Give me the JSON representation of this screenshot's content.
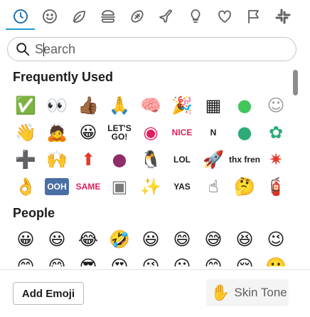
{
  "tabs": [
    {
      "name": "tab-recent",
      "icon": "clock-icon"
    },
    {
      "name": "tab-smileys",
      "icon": "smiley-icon"
    },
    {
      "name": "tab-nature",
      "icon": "leaf-icon"
    },
    {
      "name": "tab-food",
      "icon": "burger-icon"
    },
    {
      "name": "tab-activity",
      "icon": "football-icon"
    },
    {
      "name": "tab-travel",
      "icon": "airplane-icon"
    },
    {
      "name": "tab-objects",
      "icon": "lightbulb-icon"
    },
    {
      "name": "tab-symbols",
      "icon": "heart-icon"
    },
    {
      "name": "tab-flags",
      "icon": "flag-icon"
    },
    {
      "name": "tab-custom",
      "icon": "slack-icon"
    }
  ],
  "search": {
    "placeholder": "Search",
    "value": ""
  },
  "sections": {
    "frequently_used": {
      "title": "Frequently Used",
      "emojis": [
        {
          "g": "✅",
          "c": "#2ea44f"
        },
        {
          "g": "👀"
        },
        {
          "g": "👍🏾"
        },
        {
          "g": "🙏"
        },
        {
          "g": "🧠"
        },
        {
          "g": "🎉"
        },
        {
          "g": "▦",
          "c": "#1d1c1d"
        },
        {
          "g": "●",
          "c": "#43c65b"
        },
        {
          "g": "☺",
          "c": "#9e9e9e"
        },
        {
          "g": "👋"
        },
        {
          "g": "🙇"
        },
        {
          "g": "😀"
        },
        {
          "t": "LET'S GO!"
        },
        {
          "g": "◉",
          "c": "#e01e5a"
        },
        {
          "t": "NICE",
          "c": "#e01e5a"
        },
        {
          "t": "N"
        },
        {
          "g": "●",
          "c": "#2bac76"
        },
        {
          "g": "✿",
          "c": "#2bac76"
        },
        {
          "g": "➕"
        },
        {
          "g": "🙌"
        },
        {
          "g": "⬆",
          "c": "#e8392b"
        },
        {
          "g": "●",
          "c": "#8e2d6a"
        },
        {
          "g": "🐧"
        },
        {
          "t": "LOL"
        },
        {
          "g": "🚀"
        },
        {
          "t": "thx fren"
        },
        {
          "g": "✷",
          "c": "#e8392b"
        },
        {
          "g": "👌"
        },
        {
          "t": "OOH",
          "c": "#ffffff",
          "bg": "#4a6fa5"
        },
        {
          "t": "SAME",
          "c": "#e01e5a"
        },
        {
          "g": "▣",
          "c": "#7a7a7a"
        },
        {
          "g": "✨"
        },
        {
          "t": "YAS"
        },
        {
          "g": "☝"
        },
        {
          "g": "🤔"
        },
        {
          "g": "🧯"
        }
      ]
    },
    "people": {
      "title": "People",
      "emojis": [
        {
          "g": "😀"
        },
        {
          "g": "😃"
        },
        {
          "g": "😂"
        },
        {
          "g": "🤣"
        },
        {
          "g": "😃"
        },
        {
          "g": "😄"
        },
        {
          "g": "😅"
        },
        {
          "g": "😆"
        },
        {
          "g": "😉"
        },
        {
          "g": "😊"
        },
        {
          "g": "😋"
        },
        {
          "g": "😎"
        },
        {
          "g": "😍"
        },
        {
          "g": "😘"
        },
        {
          "g": "😗"
        },
        {
          "g": "😙"
        },
        {
          "g": "😚"
        },
        {
          "g": "🙂"
        }
      ]
    }
  },
  "footer": {
    "add_emoji_label": "Add Emoji",
    "skin_tone_label": "Skin Tone",
    "skin_tone_icon": "✋"
  },
  "colors": {
    "accent": "#1264a3",
    "underline": "#1d9bd1"
  }
}
